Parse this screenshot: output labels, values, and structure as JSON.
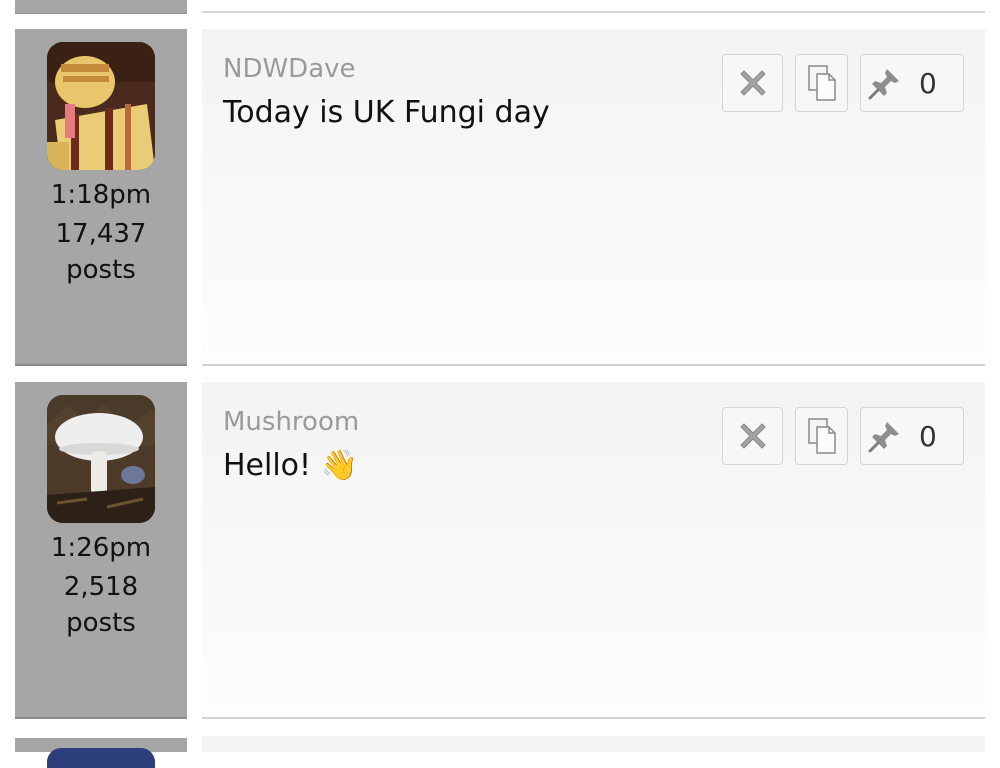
{
  "posts": [
    {
      "author": "NDWDave",
      "message": "Today is UK Fungi day",
      "emoji": "",
      "time": "1:18pm",
      "post_count": "17,437",
      "post_unit": "posts",
      "pin_count": "0",
      "avatar_icon": "knitted-toy-avatar"
    },
    {
      "author": "Mushroom",
      "message": "Hello!",
      "emoji": "👋",
      "time": "1:26pm",
      "post_count": "2,518",
      "post_unit": "posts",
      "pin_count": "0",
      "avatar_icon": "mushroom-photo-avatar"
    }
  ],
  "actions": {
    "delete_icon": "close-x-icon",
    "copy_icon": "copy-icon",
    "pin_icon": "pin-icon"
  },
  "colors": {
    "sidebar_bg": "#a6a6a6",
    "post_bg": "#f3f3f3",
    "author_text": "#9a9a9a"
  }
}
